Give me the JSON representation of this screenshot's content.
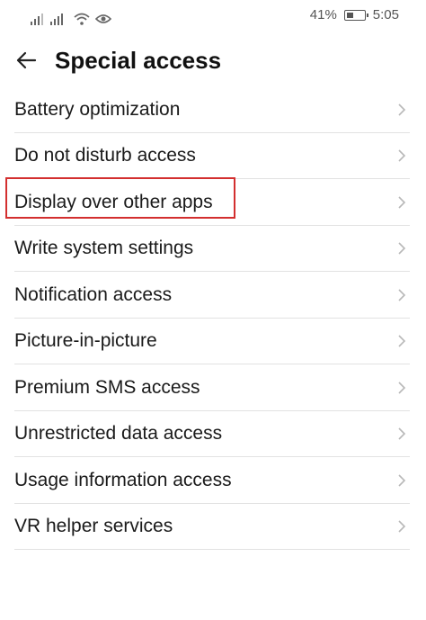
{
  "status_bar": {
    "battery_percent": "41%",
    "battery_level": 0.41,
    "time": "5:05",
    "icons": [
      "signal-icon",
      "signal-icon",
      "wifi-icon",
      "eye-comfort-icon"
    ]
  },
  "header": {
    "back_icon": "arrow-left-icon",
    "title": "Special access"
  },
  "items": [
    {
      "label": "Battery optimization"
    },
    {
      "label": "Do not disturb access"
    },
    {
      "label": "Display over other apps",
      "highlighted": true
    },
    {
      "label": "Write system settings"
    },
    {
      "label": "Notification access"
    },
    {
      "label": "Picture-in-picture"
    },
    {
      "label": "Premium SMS access"
    },
    {
      "label": "Unrestricted data access"
    },
    {
      "label": "Usage information access"
    },
    {
      "label": "VR helper services"
    }
  ],
  "colors": {
    "highlight": "#d32f2f",
    "chevron": "#b8b8b8",
    "divider": "#e2e2e2"
  }
}
